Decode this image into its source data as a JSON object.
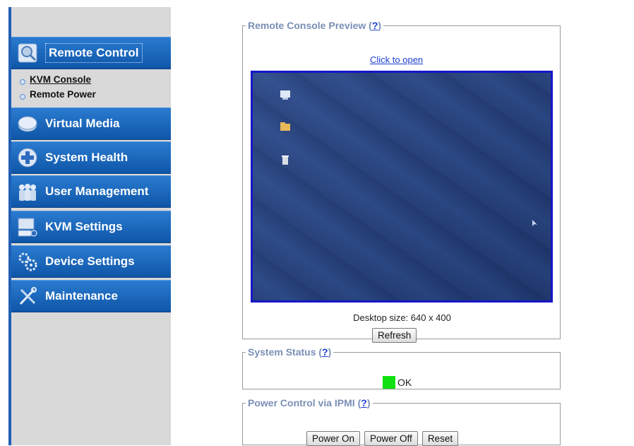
{
  "sidebar": {
    "items": [
      {
        "label": "Remote Control",
        "icon": "remote-control-icon",
        "active": true
      },
      {
        "label": "Virtual Media",
        "icon": "virtual-media-icon"
      },
      {
        "label": "System Health",
        "icon": "system-health-icon"
      },
      {
        "label": "User Management",
        "icon": "user-management-icon"
      },
      {
        "label": "KVM Settings",
        "icon": "kvm-settings-icon"
      },
      {
        "label": "Device Settings",
        "icon": "device-settings-icon"
      },
      {
        "label": "Maintenance",
        "icon": "maintenance-icon"
      }
    ],
    "subitems": [
      {
        "label": "KVM Console",
        "active": true
      },
      {
        "label": "Remote Power"
      }
    ]
  },
  "console_preview": {
    "legend": "Remote Console Preview",
    "help": "?",
    "open_link": "Click to open",
    "desktop_size": "Desktop size: 640 x 400",
    "refresh_label": "Refresh"
  },
  "system_status": {
    "legend": "System Status",
    "help": "?",
    "status_text": "OK",
    "status_color": "#11e011"
  },
  "power_control": {
    "legend": "Power Control via IPMI",
    "help": "?",
    "buttons": [
      "Power On",
      "Power Off",
      "Reset"
    ]
  },
  "colors": {
    "nav_blue": "#1a68c0",
    "sidebar_bg": "#d9d9d9",
    "preview_border": "#1616c8",
    "link": "#1a3fd0"
  }
}
